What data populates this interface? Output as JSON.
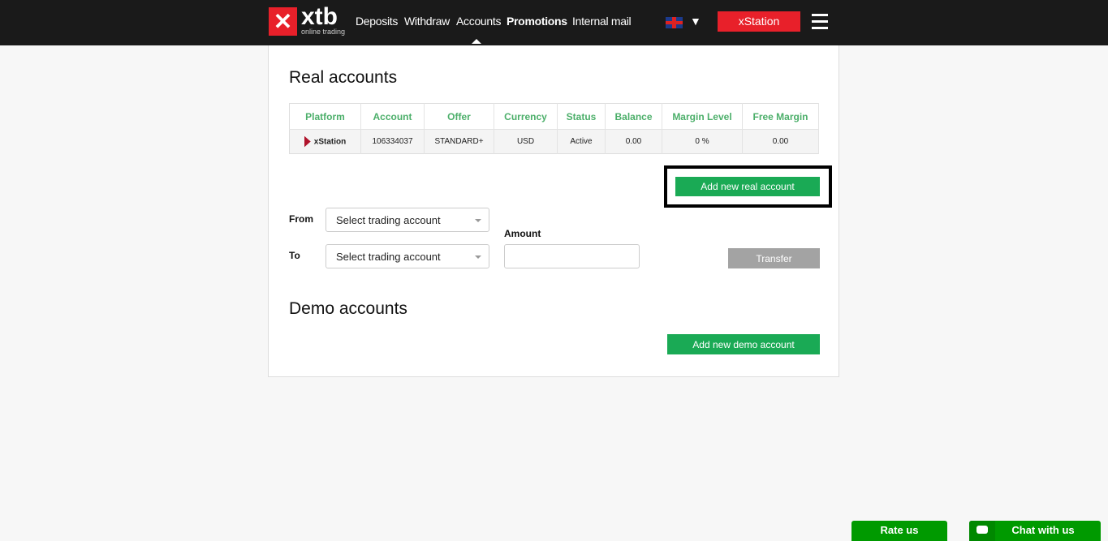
{
  "header": {
    "logo": "xtb",
    "logo_sub": "online trading",
    "nav": [
      "Deposits",
      "Withdraw",
      "Accounts",
      "Promotions",
      "Internal mail"
    ],
    "lang_arrow": "▼",
    "xstation": "xStation"
  },
  "real": {
    "title": "Real accounts",
    "columns": [
      "Platform",
      "Account",
      "Offer",
      "Currency",
      "Status",
      "Balance",
      "Margin Level",
      "Free Margin"
    ],
    "rows": [
      {
        "platform": "xStation",
        "account": "106334037",
        "offer": "STANDARD+",
        "currency": "USD",
        "status": "Active",
        "balance": "0.00",
        "margin_level": "0 %",
        "free_margin": "0.00"
      }
    ],
    "add_button": "Add new real account"
  },
  "transfer": {
    "from_label": "From",
    "to_label": "To",
    "from_select": "Select trading account",
    "to_select": "Select trading account",
    "amount_label": "Amount",
    "amount_value": "",
    "button": "Transfer"
  },
  "demo": {
    "title": "Demo accounts",
    "add_button": "Add new demo account"
  },
  "footer": {
    "rate": "Rate us",
    "chat": "Chat with us"
  },
  "colors": {
    "accent": "#1aaa55",
    "brand": "#e8202a",
    "header": "#1a1a1a"
  }
}
